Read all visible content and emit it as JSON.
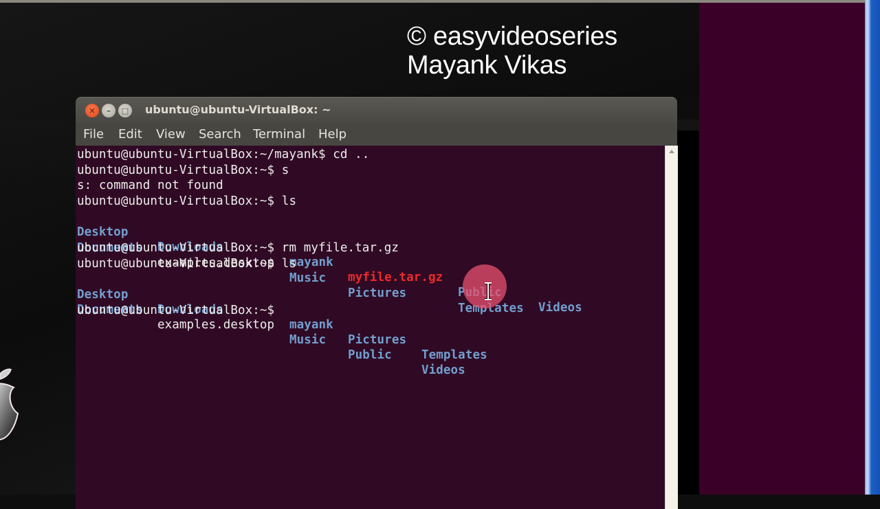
{
  "watermark": {
    "line1": "© easyvideoseries",
    "line2": "Mayank Vikas"
  },
  "window": {
    "title": "ubuntu@ubuntu-VirtualBox: ~",
    "buttons": {
      "close": "×",
      "minimize": "–",
      "maximize": "□"
    }
  },
  "menu": [
    "File",
    "Edit",
    "View",
    "Search",
    "Terminal",
    "Help"
  ],
  "terminal": {
    "prompt_home": "ubuntu@ubuntu-VirtualBox:~$",
    "lines": [
      "ubuntu@ubuntu-VirtualBox:~/mayank$ cd ..",
      "ubuntu@ubuntu-VirtualBox:~$ s",
      "s: command not found",
      "ubuntu@ubuntu-VirtualBox:~$ ls",
      "ubuntu@ubuntu-VirtualBox:~$ rm myfile.tar.gz",
      "ubuntu@ubuntu-VirtualBox:~$ ls",
      "ubuntu@ubuntu-VirtualBox:~$"
    ],
    "ls1": {
      "row1": [
        "Desktop",
        "Downloads",
        "mayank",
        "myfile.tar.gz",
        "Public",
        "Videos"
      ],
      "row2": [
        "Documents",
        "examples.desktop",
        "Music",
        "Pictures",
        "Templates"
      ]
    },
    "ls2": {
      "row1": [
        "Desktop",
        "Downloads",
        "mayank",
        "Pictures",
        "Templates"
      ],
      "row2": [
        "Documents",
        "examples.desktop",
        "Music",
        "Public",
        "Videos"
      ]
    },
    "colors": {
      "background": "#300a24",
      "text": "#eeeeec",
      "directory": "#729fcf",
      "archive": "#ef2929"
    }
  }
}
